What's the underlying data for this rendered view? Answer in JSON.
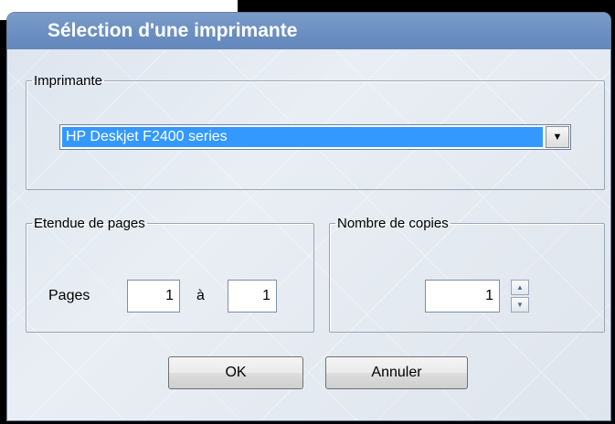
{
  "dialog": {
    "title": "Sélection d'une imprimante"
  },
  "printer_group": {
    "legend": "Imprimante",
    "selected_printer": "HP Deskjet F2400 series"
  },
  "pages_group": {
    "legend": "Etendue de pages",
    "pages_label": "Pages",
    "from_value": "1",
    "to_label": "à",
    "to_value": "1"
  },
  "copies_group": {
    "legend": "Nombre de copies",
    "copies_value": "1"
  },
  "buttons": {
    "ok_label": "OK",
    "cancel_label": "Annuler"
  },
  "icons": {
    "dropdown": "chevron-down-icon",
    "spin_up": "arrow-up-icon",
    "spin_down": "arrow-down-icon"
  },
  "colors": {
    "titlebar": "#6b8fc2",
    "selection": "#3399ff"
  }
}
